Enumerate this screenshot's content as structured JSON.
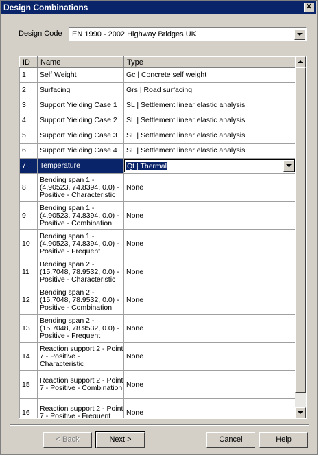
{
  "window": {
    "title": "Design Combinations",
    "close_glyph": "✕"
  },
  "design_code": {
    "label": "Design Code",
    "value": "EN 1990 - 2002 Highway Bridges UK"
  },
  "grid": {
    "columns": [
      "ID",
      "Name",
      "Type"
    ],
    "rows": [
      {
        "id": "1",
        "name": "Self Weight",
        "type": "Gc | Concrete self weight"
      },
      {
        "id": "2",
        "name": "Surfacing",
        "type": "Grs | Road surfacing"
      },
      {
        "id": "3",
        "name": "Support Yielding Case 1",
        "type": "SL | Settlement linear elastic analysis"
      },
      {
        "id": "4",
        "name": "Support Yielding Case 2",
        "type": "SL | Settlement linear elastic analysis"
      },
      {
        "id": "5",
        "name": "Support Yielding Case 3",
        "type": "SL | Settlement linear elastic analysis"
      },
      {
        "id": "6",
        "name": "Support Yielding Case 4",
        "type": "SL | Settlement linear elastic analysis"
      },
      {
        "id": "7",
        "name": "Temperature",
        "type": "Qt | Thermal",
        "selected": true
      },
      {
        "id": "8",
        "name": "Bending span 1 - (4.90523, 74.8394, 0.0) - Positive - Characteristic",
        "type": "None"
      },
      {
        "id": "9",
        "name": "Bending span 1 - (4.90523, 74.8394, 0.0) - Positive - Combination",
        "type": "None"
      },
      {
        "id": "10",
        "name": "Bending span 1 - (4.90523, 74.8394, 0.0) - Positive - Frequent",
        "type": "None"
      },
      {
        "id": "11",
        "name": "Bending span 2 - (15.7048, 78.9532, 0.0) - Positive - Characteristic",
        "type": "None"
      },
      {
        "id": "12",
        "name": "Bending span 2 - (15.7048, 78.9532, 0.0) - Positive - Combination",
        "type": "None"
      },
      {
        "id": "13",
        "name": "Bending span 2 - (15.7048, 78.9532, 0.0) - Positive - Frequent",
        "type": "None"
      },
      {
        "id": "14",
        "name": "Reaction support 2 - Point 7 - Positive - Characteristic",
        "type": "None"
      },
      {
        "id": "15",
        "name": "Reaction support 2 - Point 7 - Positive - Combination",
        "type": "None"
      },
      {
        "id": "16",
        "name": "Reaction support 2 - Point 7 - Positive - Frequent",
        "type": "None"
      }
    ]
  },
  "buttons": {
    "back": "< Back",
    "next": "Next >",
    "cancel": "Cancel",
    "help": "Help"
  }
}
